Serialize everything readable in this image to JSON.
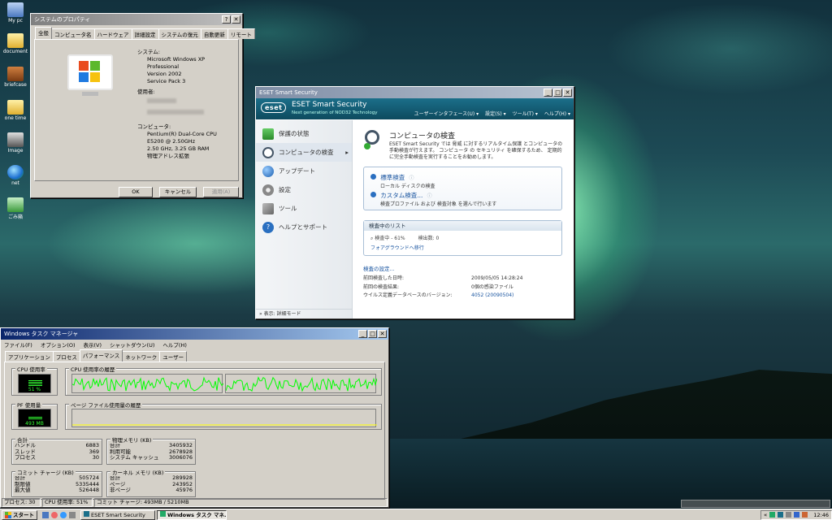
{
  "desktop_icons": [
    {
      "label": "My pc",
      "icon": "computer-icon"
    },
    {
      "label": "document",
      "icon": "folder-icon"
    },
    {
      "label": "briefcase",
      "icon": "briefcase-icon"
    },
    {
      "label": "one time",
      "icon": "folder-icon"
    },
    {
      "label": "Image",
      "icon": "camera-icon"
    },
    {
      "label": "net",
      "icon": "globe-icon"
    },
    {
      "label": "ごみ箱",
      "icon": "recycle-bin-icon"
    }
  ],
  "sysprop": {
    "title": "システムのプロパティ",
    "tabs": [
      "全般",
      "コンピュータ名",
      "ハードウェア",
      "詳細設定",
      "システムの復元",
      "自動更新",
      "リモート"
    ],
    "system_heading": "システム:",
    "system_lines": [
      "Microsoft Windows XP",
      "Professional",
      "Version 2002",
      "Service Pack 3"
    ],
    "user_heading": "使用者:",
    "computer_heading": "コンピュータ:",
    "computer_lines": [
      "Pentium(R) Dual-Core  CPU",
      "  E5200  @ 2.50GHz",
      "2.50 GHz, 3.25 GB RAM",
      "物理アドレス拡張"
    ],
    "ok": "OK",
    "cancel": "キャンセル",
    "apply": "適用(A)"
  },
  "eset": {
    "title": "ESET Smart Security",
    "logo": "eset",
    "product": "ESET Smart Security",
    "tagline": "Next generation of NOD32 Technology",
    "menu": [
      "ユーザーインタフェース(U) ▾",
      "設定(S) ▾",
      "ツール(T) ▾",
      "ヘルプ(H) ▾"
    ],
    "nav": [
      {
        "label": "保護の状態",
        "icon": "shield-check-icon"
      },
      {
        "label": "コンピュータの検査",
        "icon": "magnifier-icon"
      },
      {
        "label": "アップデート",
        "icon": "globe-update-icon"
      },
      {
        "label": "設定",
        "icon": "gear-icon"
      },
      {
        "label": "ツール",
        "icon": "tools-icon"
      },
      {
        "label": "ヘルプとサポート",
        "icon": "help-icon"
      }
    ],
    "view_mode": "表示: 詳細モード",
    "heading": "コンピュータの検査",
    "description": "ESET Smart Security では 脅威 に対するリアルタイム保護 とコンピュータの手動検査が行えます。 コンピュータ の セキュリティ を確保するため、 定期的に完全手動検査を実行することをお勧めします。",
    "scan1_title": "標準検査",
    "scan1_desc": "ローカル ディスクの検査",
    "scan2_title": "カスタム検査...",
    "scan2_desc": "検査プロファイル および 検査対象 を選んで行います",
    "list_title": "検査中のリスト",
    "progress_label": "検査中 - 61%",
    "detected_label": "検出数: 0",
    "background_link": "フォアグラウンドへ移行",
    "settings_link": "検査の設定...",
    "info": [
      {
        "label": "前回検査した日時:",
        "value": "2009/05/05 14:28:24"
      },
      {
        "label": "前回の検査結果:",
        "value": "0個の感染ファイル"
      },
      {
        "label": "ウイルス定義データベースのバージョン:",
        "value": "4052 (20090504)"
      }
    ]
  },
  "taskmgr": {
    "title": "Windows タスク マネージャ",
    "menu": [
      "ファイル(F)",
      "オプション(O)",
      "表示(V)",
      "シャットダウン(U)",
      "ヘルプ(H)"
    ],
    "tabs": [
      "アプリケーション",
      "プロセス",
      "パフォーマンス",
      "ネットワーク",
      "ユーザー"
    ],
    "cpu_usage_label": "CPU 使用率",
    "cpu_usage_value": "51 %",
    "cpu_usage_percent": 51,
    "cpu_history_label": "CPU 使用率の履歴",
    "pf_label": "PF 使用量",
    "pf_value": "493 MB",
    "pf_history_label": "ページ ファイル使用量の履歴",
    "totals": {
      "heading": "合計",
      "rows": [
        {
          "k": "ハンドル",
          "v": "6883"
        },
        {
          "k": "スレッド",
          "v": "369"
        },
        {
          "k": "プロセス",
          "v": "30"
        }
      ]
    },
    "physical": {
      "heading": "物理メモリ (KB)",
      "rows": [
        {
          "k": "合計",
          "v": "3405932"
        },
        {
          "k": "利用可能",
          "v": "2678928"
        },
        {
          "k": "システム キャッシュ",
          "v": "3006076"
        }
      ]
    },
    "commit": {
      "heading": "コミット チャージ (KB)",
      "rows": [
        {
          "k": "合計",
          "v": "505724"
        },
        {
          "k": "制限値",
          "v": "5335444"
        },
        {
          "k": "最大値",
          "v": "526448"
        }
      ]
    },
    "kernel": {
      "heading": "カーネル メモリ (KB)",
      "rows": [
        {
          "k": "合計",
          "v": "289928"
        },
        {
          "k": "ページ",
          "v": "243952"
        },
        {
          "k": "非ページ",
          "v": "45976"
        }
      ]
    },
    "status": [
      "プロセス: 30",
      "CPU 使用率: 51%",
      "コミット チャージ: 493MB / 5210MB"
    ]
  },
  "taskbar": {
    "start": "スタート",
    "items": [
      "ESET Smart Security",
      "Windows タスク マネ..."
    ],
    "clock": "12:46"
  }
}
